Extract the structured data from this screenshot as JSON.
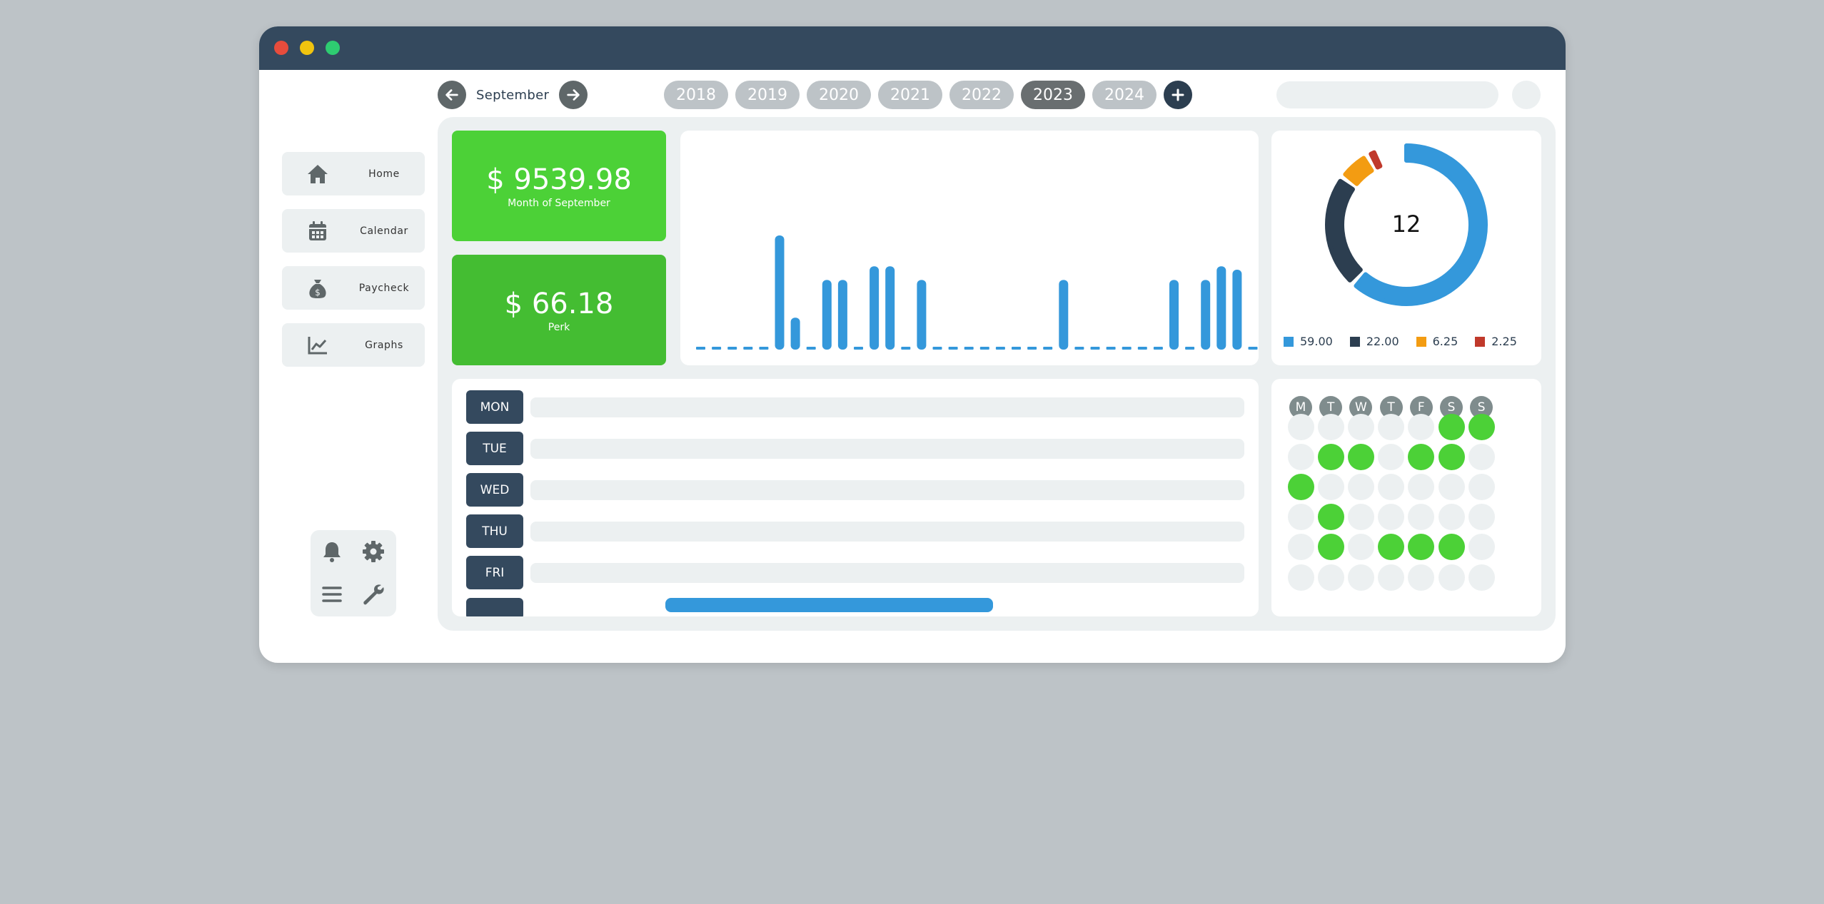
{
  "nav": {
    "month": "September",
    "prev_icon": "arrow-left-icon",
    "next_icon": "arrow-right-icon"
  },
  "years": {
    "items": [
      "2018",
      "2019",
      "2020",
      "2021",
      "2022",
      "2023",
      "2024"
    ],
    "active": "2023",
    "add_icon": "plus-icon"
  },
  "sidebar": {
    "items": [
      {
        "label": "Home",
        "icon": "home-icon"
      },
      {
        "label": "Calendar",
        "icon": "calendar-icon"
      },
      {
        "label": "Paycheck",
        "icon": "money-bag-icon"
      },
      {
        "label": "Graphs",
        "icon": "line-chart-icon"
      }
    ],
    "tools": [
      "bell-icon",
      "gear-icon",
      "menu-icon",
      "wrench-icon"
    ]
  },
  "cards": {
    "month_total": {
      "amount": "$ 9539.98",
      "label": "Month of September",
      "color": "#4cd137"
    },
    "perk": {
      "amount": "$ 66.18",
      "label": "Perk",
      "color": "#44bd32"
    }
  },
  "week": {
    "days": [
      "MON",
      "TUE",
      "WED",
      "THU",
      "FRI"
    ],
    "progress": 0.45
  },
  "calendar": {
    "headers": [
      "M",
      "T",
      "W",
      "T",
      "F",
      "S",
      "S"
    ],
    "grid": [
      [
        0,
        0,
        0,
        0,
        0,
        1,
        1
      ],
      [
        0,
        1,
        1,
        0,
        1,
        1,
        0
      ],
      [
        1,
        0,
        0,
        0,
        0,
        0,
        0
      ],
      [
        0,
        1,
        0,
        0,
        0,
        0,
        0
      ],
      [
        0,
        1,
        0,
        1,
        1,
        1,
        0
      ],
      [
        0,
        0,
        0,
        0,
        0,
        0,
        0
      ]
    ],
    "on_color": "#4cd137",
    "off_color": "#ecf0f1"
  },
  "chart_data": [
    {
      "type": "bar",
      "title": "",
      "xlabel": "",
      "ylabel": "",
      "ylim": [
        0,
        100
      ],
      "values": [
        1,
        1,
        1,
        1,
        1,
        100,
        28,
        1,
        61,
        61,
        1,
        73,
        73,
        1,
        61,
        1,
        1,
        1,
        1,
        1,
        1,
        1,
        1,
        61,
        1,
        1,
        1,
        1,
        1,
        1,
        61,
        1,
        61,
        73,
        70,
        1
      ],
      "color": "#3498db"
    },
    {
      "type": "pie",
      "center_label": "12",
      "slices": [
        {
          "label": "59.00",
          "value": 59.0,
          "color": "#3498db"
        },
        {
          "label": "22.00",
          "value": 22.0,
          "color": "#2c3e50"
        },
        {
          "label": "6.25",
          "value": 6.25,
          "color": "#f39c12"
        },
        {
          "label": "2.25",
          "value": 2.25,
          "color": "#c0392b"
        }
      ]
    }
  ]
}
